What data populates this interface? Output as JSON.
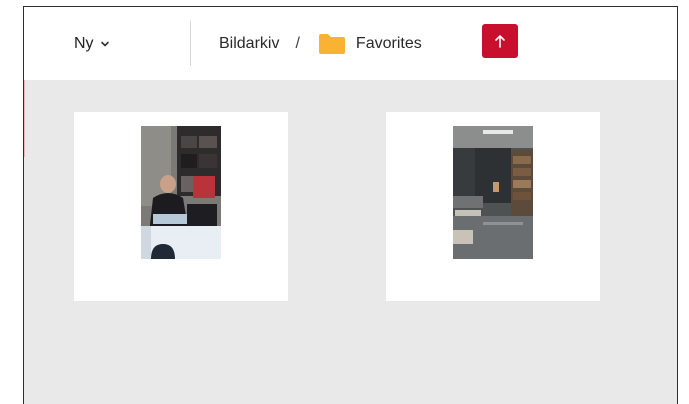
{
  "toolbar": {
    "new_label": "Ny",
    "new_icon": "chevron-down-icon",
    "breadcrumb": {
      "root_label": "Bildarkiv",
      "separator": "/",
      "current_label": "Favorites",
      "folder_icon": "folder-icon"
    },
    "up_icon": "arrow-up-icon",
    "accent_color": "#c8102e",
    "folder_color": "#f9b233"
  },
  "grid": {
    "items": [
      {
        "kind": "photo",
        "thumb_icon": "person-at-desk-photo"
      },
      {
        "kind": "photo",
        "thumb_icon": "office-interior-photo"
      }
    ]
  }
}
